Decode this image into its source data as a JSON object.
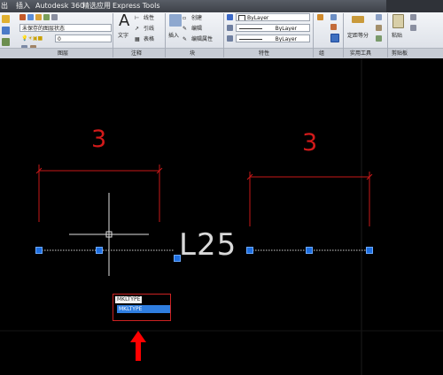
{
  "tabs": [
    "出",
    "插入",
    "Autodesk 360",
    "精选应用",
    "Express Tools"
  ],
  "ribbon": {
    "layer": {
      "state": "未保存的图层状态",
      "current": "0",
      "title": "图层"
    },
    "annotation": {
      "text_label": "文字",
      "linear": "线性",
      "leader": "引线",
      "table": "表格",
      "title": "注释"
    },
    "block": {
      "insert": "插入",
      "create": "创建",
      "edit": "编辑",
      "edit_attr": "编辑属性",
      "title": "块"
    },
    "properties": {
      "color": "ByLayer",
      "linetype": "ByLayer",
      "lineweight": "ByLayer",
      "title": "特性"
    },
    "group_title": "组",
    "utilities": {
      "measure": "定距等分",
      "title": "实用工具"
    },
    "clipboard": {
      "paste": "粘贴",
      "title": "剪贴板"
    }
  },
  "drawing": {
    "dim_left": "3",
    "dim_right": "3",
    "linetype_text": "L25",
    "tooltip_1": "MKLTYPE",
    "tooltip_2": "MKLTYPE"
  },
  "colors": {
    "dimension": "#d21a1a",
    "grip": "#1f6fe0",
    "arrow": "#ff0000"
  }
}
